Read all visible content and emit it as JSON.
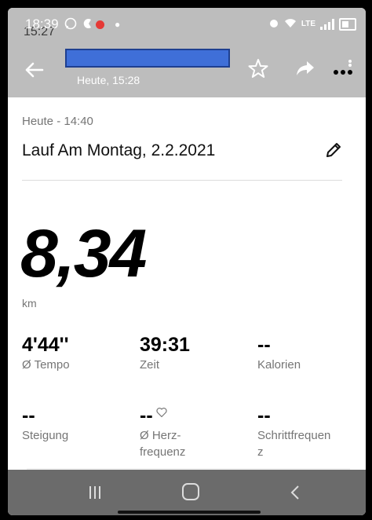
{
  "status": {
    "time": "18:39",
    "time_ghost": "15:27",
    "network": "LTE"
  },
  "appbar": {
    "subtitle": "Heute, 15:28"
  },
  "activity": {
    "date": "Heute - 14:40",
    "title": "Lauf Am Montag, 2.2.2021",
    "distance": "8,34",
    "distance_unit": "km"
  },
  "stats": [
    {
      "value": "4'44''",
      "label": "Ø Tempo"
    },
    {
      "value": "39:31",
      "label": "Zeit"
    },
    {
      "value": "--",
      "label": "Kalorien"
    },
    {
      "value": "--",
      "label": "Steigung"
    },
    {
      "value": "--",
      "label": "Ø Herz-\nfrequenz"
    },
    {
      "value": "--",
      "label": "Schrittfrequen\nz"
    }
  ],
  "colors": {
    "appbar": "#bdbdbd",
    "navbar": "#6b6b6b",
    "redaction": "#3f6fd8",
    "record_dot": "#e53935"
  },
  "icons": {
    "back": "arrow-left-icon",
    "favorite": "star-outline-icon",
    "share": "share-arrow-icon",
    "more": "more-dots-icon",
    "edit": "pencil-icon",
    "heart": "heart-outline-icon"
  }
}
